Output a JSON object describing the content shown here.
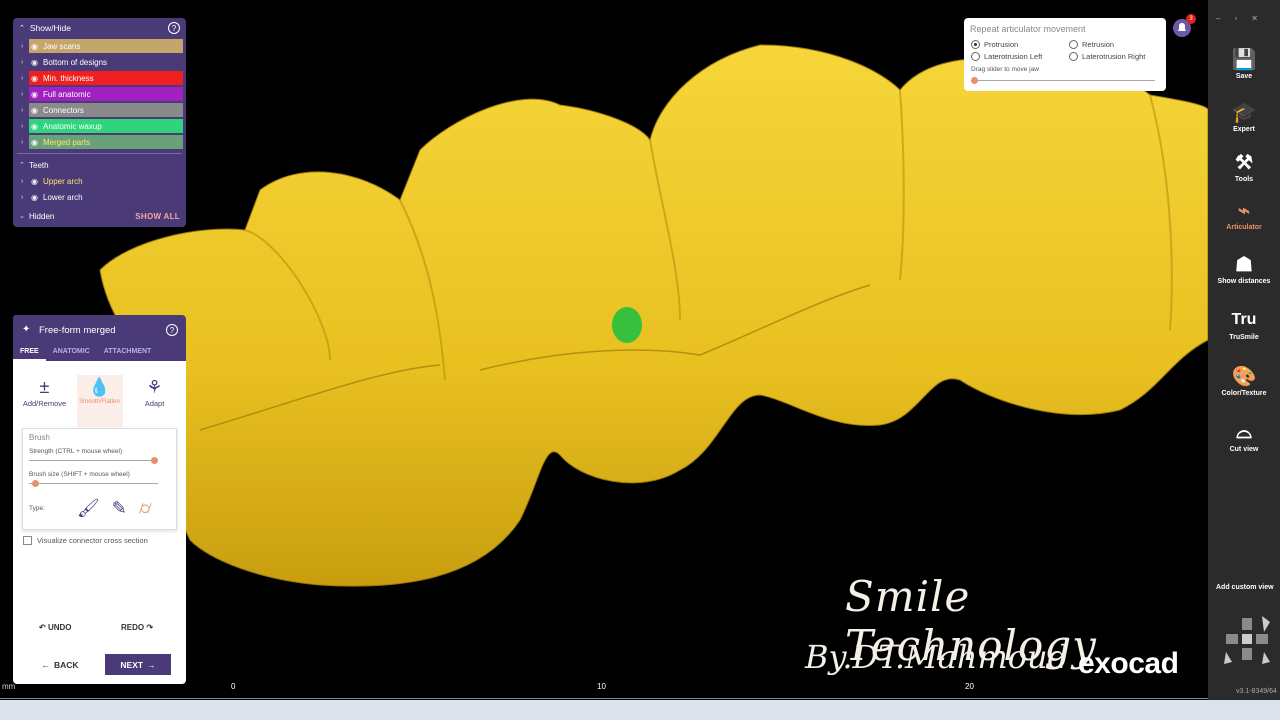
{
  "show_hide": {
    "title": "Show/Hide",
    "help": "?",
    "items": [
      {
        "label": "Jaw scans",
        "color": "#c4a66a"
      },
      {
        "label": "Bottom of designs",
        "color": ""
      },
      {
        "label": "Min. thickness",
        "color": "#f02020"
      },
      {
        "label": "Full anatomic",
        "color": "#a020c0"
      },
      {
        "label": "Connectors",
        "color": "#8a8a8a"
      },
      {
        "label": "Anatomic waxup",
        "color": "#30d47a"
      },
      {
        "label": "Merged parts",
        "color": "#6aa07a"
      }
    ],
    "teeth_label": "Teeth",
    "teeth": [
      {
        "label": "Upper arch"
      },
      {
        "label": "Lower arch"
      }
    ],
    "hidden_label": "Hidden",
    "show_all": "SHOW ALL"
  },
  "freeform": {
    "title": "Free-form merged",
    "help": "?",
    "tabs": [
      "FREE",
      "ANATOMIC",
      "ATTACHMENT"
    ],
    "tools": [
      {
        "label": "Add/Remove",
        "icon": "plus-minus-icon"
      },
      {
        "label": "Smooth/Flatten",
        "icon": "drop-icon"
      },
      {
        "label": "Adapt",
        "icon": "adapt-icon"
      }
    ],
    "brush_title": "Brush",
    "strength_label": "Strength (CTRL + mouse wheel)",
    "strength": 0.95,
    "size_label": "Brush size (SHIFT + mouse wheel)",
    "size": 0.02,
    "type_label": "Type:",
    "checkbox_label": "Visualize connector cross section",
    "undo": "UNDO",
    "redo": "REDO",
    "back": "BACK",
    "next": "NEXT"
  },
  "articulator": {
    "title": "Repeat articulator movement",
    "options": [
      "Protrusion",
      "Retrusion",
      "Laterotrusion Left",
      "Laterotrusion Right"
    ],
    "selected": "Protrusion",
    "hint": "Drag slider to move jaw",
    "position": 0.0
  },
  "notifications": {
    "count": "3"
  },
  "sidebar": {
    "items": [
      {
        "label": "Save",
        "icon": "save-icon"
      },
      {
        "label": "Expert",
        "icon": "graduation-cap-icon"
      },
      {
        "label": "Tools",
        "icon": "tools-icon"
      },
      {
        "label": "Articulator",
        "icon": "articulator-icon"
      },
      {
        "label": "Show distances",
        "icon": "distances-icon"
      },
      {
        "label": "TruSmile",
        "icon": "trusmile-icon"
      },
      {
        "label": "Color/Texture",
        "icon": "palette-icon"
      },
      {
        "label": "Cut view",
        "icon": "cut-view-icon"
      }
    ],
    "add_custom_view": "Add custom view",
    "version": "v3.1-8349/64"
  },
  "ruler": {
    "unit": "mm",
    "ticks": [
      "0",
      "10",
      "20"
    ]
  },
  "watermark": {
    "line1": "Smile Technology",
    "line2": "By.DT.Mahmoud",
    "brand": "exocad"
  },
  "colors": {
    "panel": "#4b3a78",
    "accent": "#e8906a",
    "tooth": "#f2cc28"
  }
}
